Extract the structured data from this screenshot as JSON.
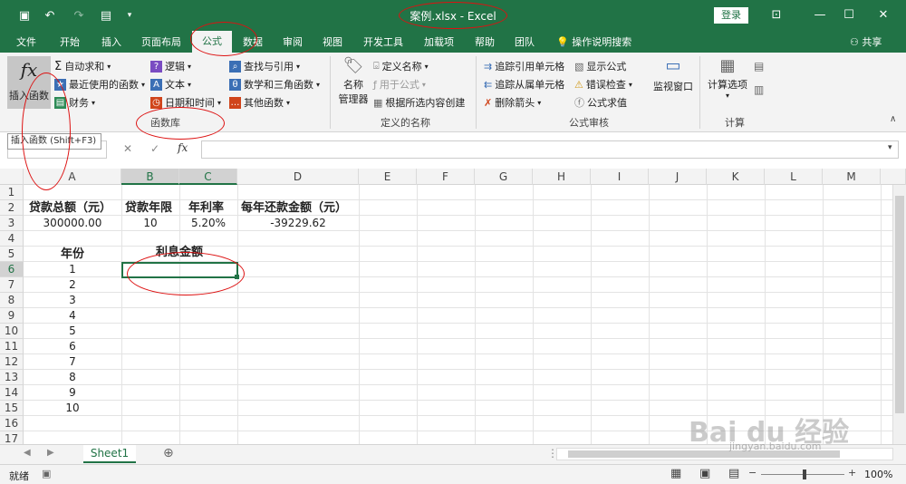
{
  "window": {
    "title": "案例.xlsx  -  Excel",
    "login": "登录"
  },
  "qat": {
    "save_icon": "save-icon",
    "undo_icon": "undo-icon",
    "redo_icon": "redo-icon"
  },
  "tabs": [
    "文件",
    "开始",
    "插入",
    "页面布局",
    "公式",
    "数据",
    "审阅",
    "视图",
    "开发工具",
    "加载项",
    "帮助",
    "团队"
  ],
  "active_tab": "公式",
  "tell_me": "操作说明搜索",
  "share": "共享",
  "ribbon": {
    "insert_function": "插入函数",
    "autosum": "自动求和",
    "recent": "最近使用的函数",
    "financial": "财务",
    "logical": "逻辑",
    "text": "文本",
    "datetime": "日期和时间",
    "lookup": "查找与引用",
    "math": "数学和三角函数",
    "other": "其他函数",
    "group_library": "函数库",
    "name_manager_1": "名称",
    "name_manager_2": "管理器",
    "define_name": "定义名称",
    "use_in_formula": "用于公式",
    "create_from_sel": "根据所选内容创建",
    "group_names": "定义的名称",
    "trace_precedents": "追踪引用单元格",
    "trace_dependents": "追踪从属单元格",
    "remove_arrows": "删除箭头",
    "show_formulas": "显示公式",
    "error_check": "错误检查",
    "evaluate": "公式求值",
    "watch_window": "监视窗口",
    "group_audit": "公式审核",
    "calc_options": "计算选项",
    "group_calc": "计算"
  },
  "tooltip": "插入函数 (Shift+F3)",
  "formula_bar": {
    "fx": "fx",
    "cancel": "✕",
    "enter": "✓"
  },
  "columns": [
    "A",
    "B",
    "C",
    "D",
    "E",
    "F",
    "G",
    "H",
    "I",
    "J",
    "K",
    "L",
    "M"
  ],
  "rows": [
    "1",
    "2",
    "3",
    "4",
    "5",
    "6",
    "7",
    "8",
    "9",
    "10",
    "11",
    "12",
    "13",
    "14",
    "15",
    "16",
    "17"
  ],
  "cells": {
    "A2": "贷款总额（元）",
    "B2": "贷款年限",
    "C2": "年利率",
    "D2": "每年还款金额（元）",
    "A3": "300000.00",
    "B3": "10",
    "C3": "5.20%",
    "D3": "-39229.62",
    "A5": "年份",
    "B5": "利息金额",
    "A6": "1",
    "A7": "2",
    "A8": "3",
    "A9": "4",
    "A10": "5",
    "A11": "6",
    "A12": "7",
    "A13": "8",
    "A14": "9",
    "A15": "10"
  },
  "sheet_tab": "Sheet1",
  "status": {
    "ready": "就绪",
    "zoom": "100%"
  },
  "watermark": {
    "main": "Bai du 经验",
    "sub": "jingyan.baidu.com"
  },
  "colors": {
    "accent": "#217346",
    "annotation": "#dd1111"
  }
}
